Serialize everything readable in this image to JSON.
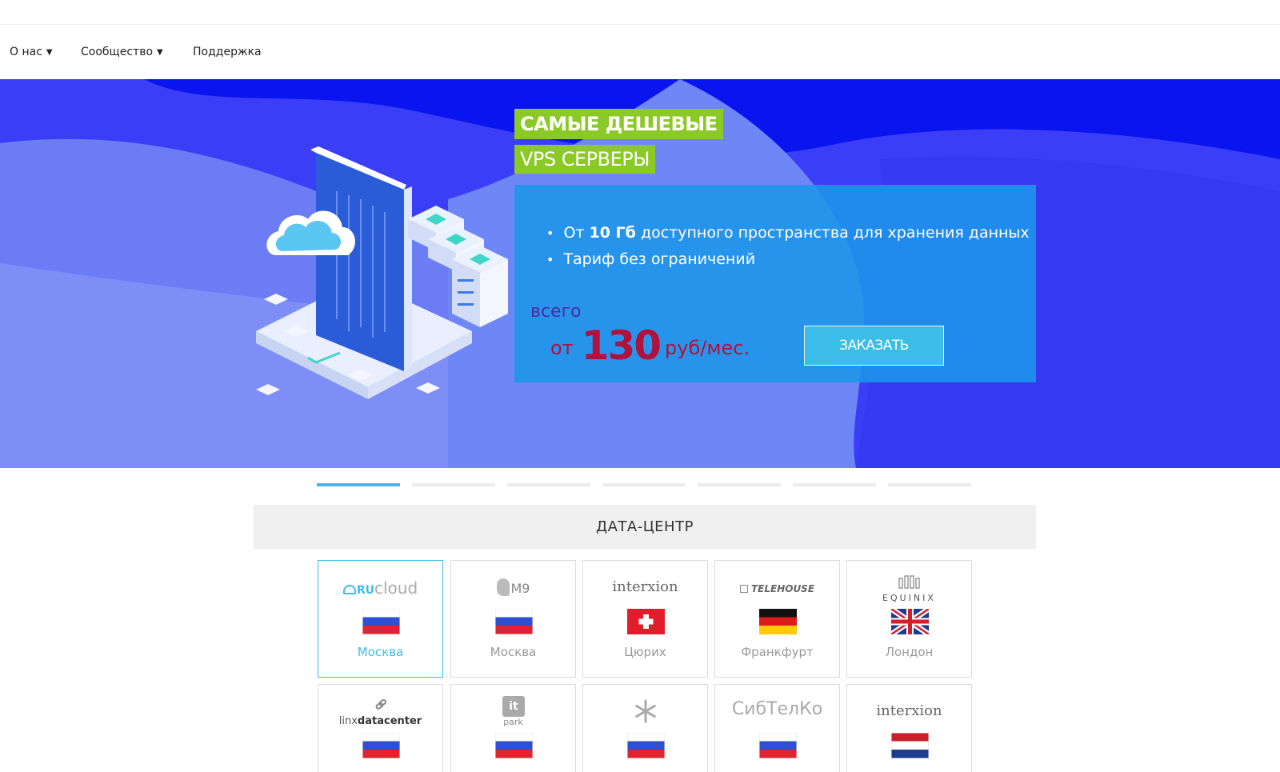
{
  "nav": {
    "items": [
      {
        "label": "О нас",
        "has_dropdown": true
      },
      {
        "label": "Сообщество",
        "has_dropdown": true
      },
      {
        "label": "Поддержка",
        "has_dropdown": false
      }
    ],
    "caret": "▼"
  },
  "hero": {
    "headline_1": "САМЫЕ ДЕШЕВЫЕ",
    "headline_2": "VPS СЕРВЕРЫ",
    "bullet_1_pre": "От ",
    "bullet_1_bold": "10 Гб",
    "bullet_1_post": " доступного пространства для хранения данных",
    "bullet_2": "Тариф без ограничений",
    "price_prefix": "всего",
    "price_from": "от",
    "price_value": "130",
    "price_unit": "руб/мес.",
    "order_button": "ЗАКАЗАТЬ",
    "colors": {
      "background": "#2e33f5",
      "highlight": "#8bc926",
      "price": "#b0123c",
      "button": "#3cbde8"
    }
  },
  "slider": {
    "slide_count": 7,
    "active_index": 0
  },
  "datacenter": {
    "title": "ДАТА-ЦЕНТР",
    "cards": [
      {
        "logo": "RUcloud",
        "logo_ru": "RU",
        "logo_rest": "cloud",
        "flag": "russia-flag-icon",
        "city": "Москва",
        "active": true
      },
      {
        "logo": "M9",
        "flag": "russia-flag-icon",
        "city": "Москва",
        "active": false
      },
      {
        "logo": "interxion",
        "flag": "switzerland-flag-icon",
        "city": "Цюрих",
        "active": false
      },
      {
        "logo": "TELEHOUSE",
        "flag": "germany-flag-icon",
        "city": "Франкфурт",
        "active": false
      },
      {
        "logo": "EQUINIX",
        "flag": "uk-flag-icon",
        "city": "Лондон",
        "active": false
      },
      {
        "logo_pre": "linx",
        "logo_bold": "datacenter",
        "flag": "russia-flag-icon",
        "city": "",
        "active": false
      },
      {
        "logo": "park",
        "flag": "russia-flag-icon",
        "city": "",
        "active": false
      },
      {
        "logo": "snowflake-icon",
        "flag": "russia-flag-icon",
        "city": "",
        "active": false
      },
      {
        "logo": "СибТелКо",
        "flag": "russia-flag-icon",
        "city": "",
        "active": false
      },
      {
        "logo": "interxion",
        "flag": "netherlands-flag-icon",
        "city": "",
        "active": false
      }
    ]
  }
}
